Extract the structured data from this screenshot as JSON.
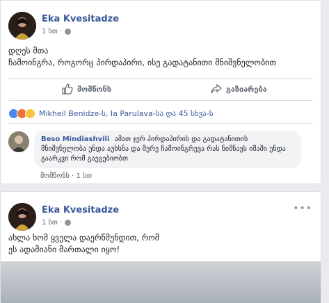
{
  "post1": {
    "author": "Eka Kvesitadze",
    "time": "1 სთ ·",
    "text_line1": "დღეს მთა",
    "text_line2": "ჩამოინგრა, როგორც პირდაპირი, ისე გადატანითი მნიშვნელობით",
    "like_label": "მომწონს",
    "share_label": "გაზიარება",
    "reactions_text": "Mikheil Benidze-ს, Ia Parulava-სა და 45 სხვა-ს",
    "comment": {
      "author": "Beso Mindiashvili",
      "text": "ამათ ჯერ პირდაპირის და გადატანითის მნიშვნელობა უნდა აუხსნა და მერე ჩამოინგრევა რას ნიშნავს იმაში უნდა გაარკვი რომ გაეგებიობთ",
      "like": "მომწონს",
      "time": "· 1 სთ"
    }
  },
  "post2": {
    "author": "Eka Kvesitadze",
    "time": "1 სთ ·",
    "text_line1": "ახლა ხომ ყველა დაერწმუნდით, რომ",
    "text_line2": "ეს ადამიანი მართალი იყო!"
  },
  "icons": {
    "globe": "globe-icon",
    "like": "thumbs-up-icon",
    "share": "share-arrow-icon",
    "menu": "more-options-icon"
  }
}
